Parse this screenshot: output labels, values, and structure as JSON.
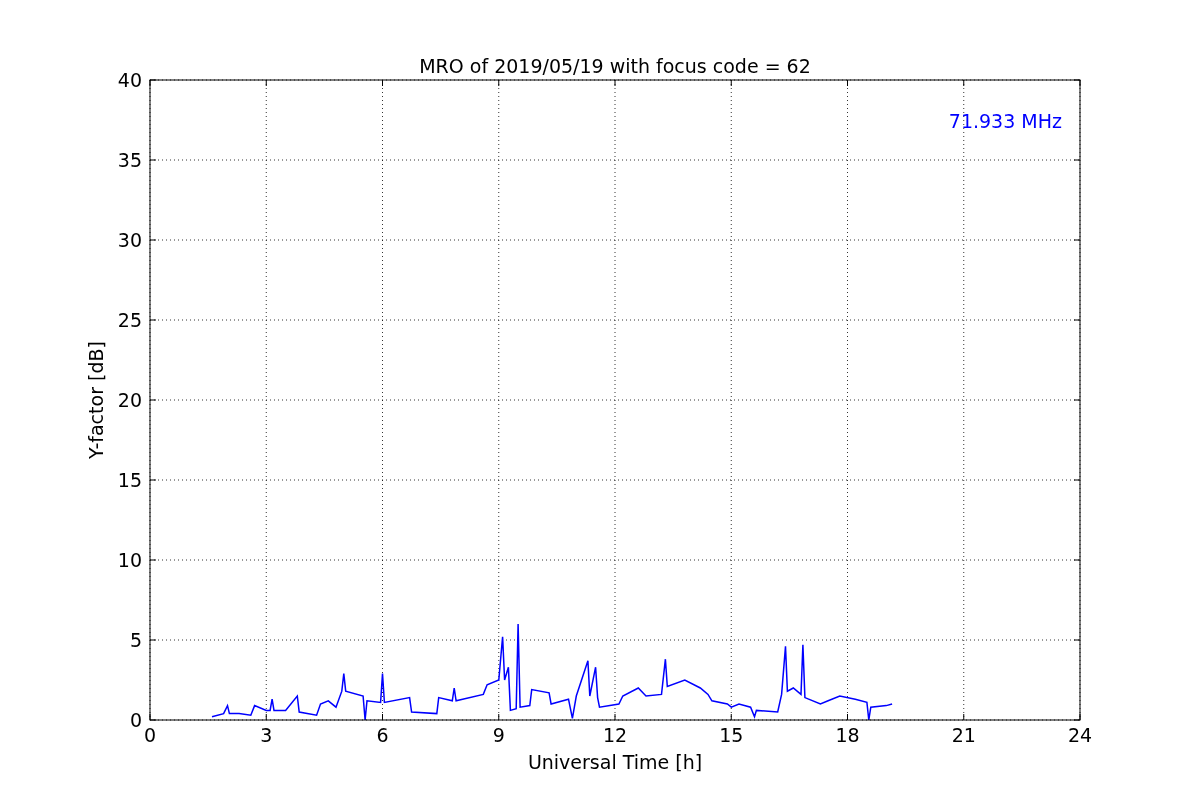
{
  "chart_data": {
    "type": "line",
    "title": "MRO of 2019/05/19 with focus code = 62",
    "xlabel": "Universal Time [h]",
    "ylabel": "Y-factor [dB]",
    "x": [
      1.6,
      1.9,
      2.0,
      2.05,
      2.3,
      2.6,
      2.7,
      3.0,
      3.1,
      3.15,
      3.2,
      3.5,
      3.8,
      3.85,
      4.3,
      4.4,
      4.6,
      4.8,
      4.95,
      5.0,
      5.05,
      5.5,
      5.55,
      5.6,
      5.95,
      6.0,
      6.05,
      6.7,
      6.75,
      7.4,
      7.45,
      7.8,
      7.85,
      7.9,
      8.6,
      8.7,
      9.0,
      9.1,
      9.15,
      9.25,
      9.3,
      9.45,
      9.5,
      9.55,
      9.8,
      9.85,
      10.3,
      10.35,
      10.8,
      10.9,
      11.0,
      11.3,
      11.35,
      11.5,
      11.55,
      11.6,
      12.1,
      12.2,
      12.6,
      12.8,
      13.2,
      13.3,
      13.35,
      13.8,
      14.2,
      14.4,
      14.5,
      14.9,
      15.0,
      15.2,
      15.5,
      15.6,
      15.65,
      16.2,
      16.3,
      16.4,
      16.45,
      16.6,
      16.8,
      16.85,
      16.9,
      17.3,
      17.5,
      17.8,
      18.2,
      18.5,
      18.55,
      18.6,
      19.0,
      19.15
    ],
    "series": [
      {
        "name": "71.933 MHz",
        "color": "#0000ff",
        "values": [
          0.2,
          0.4,
          0.9,
          0.4,
          0.4,
          0.3,
          0.9,
          0.6,
          0.6,
          1.3,
          0.6,
          0.6,
          1.5,
          0.5,
          0.3,
          1.0,
          1.2,
          0.8,
          1.8,
          2.9,
          1.8,
          1.5,
          0.0,
          1.2,
          1.1,
          2.9,
          1.1,
          1.4,
          0.5,
          0.4,
          1.4,
          1.2,
          2.0,
          1.2,
          1.6,
          2.2,
          2.5,
          5.2,
          2.5,
          3.3,
          0.6,
          0.7,
          6.0,
          0.8,
          0.9,
          1.9,
          1.7,
          1.0,
          1.3,
          0.1,
          1.5,
          3.7,
          1.5,
          3.3,
          1.4,
          0.8,
          1.0,
          1.5,
          2.0,
          1.5,
          1.6,
          3.8,
          2.1,
          2.5,
          2.0,
          1.6,
          1.2,
          1.0,
          0.8,
          1.0,
          0.8,
          0.2,
          0.6,
          0.5,
          1.6,
          4.6,
          1.8,
          2.0,
          1.6,
          4.7,
          1.4,
          1.0,
          1.2,
          1.5,
          1.3,
          1.1,
          0.0,
          0.8,
          0.9,
          1.0
        ]
      }
    ],
    "xlim": [
      0,
      24
    ],
    "ylim": [
      0,
      40
    ],
    "xticks": [
      0,
      3,
      6,
      9,
      12,
      15,
      18,
      21,
      24
    ],
    "yticks": [
      0,
      5,
      10,
      15,
      20,
      25,
      30,
      35,
      40
    ],
    "grid": true
  }
}
